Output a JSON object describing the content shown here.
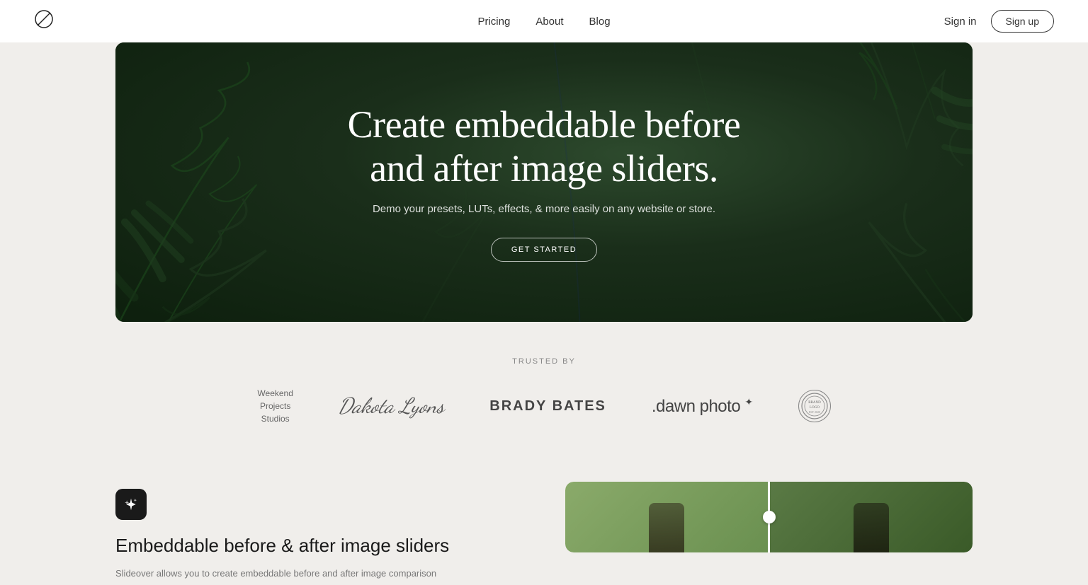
{
  "nav": {
    "logo_symbol": "∅",
    "links": [
      {
        "label": "Pricing",
        "href": "#"
      },
      {
        "label": "About",
        "href": "#"
      },
      {
        "label": "Blog",
        "href": "#"
      }
    ],
    "sign_in_label": "Sign in",
    "sign_up_label": "Sign up"
  },
  "hero": {
    "title_line1": "Create embeddable before",
    "title_line2": "and after image sliders.",
    "subtitle": "Demo your presets, LUTs, effects, & more easily on any website or store.",
    "cta_label": "GET STARTED"
  },
  "trusted": {
    "label": "TRUSTED BY",
    "logos": [
      {
        "id": "weekend",
        "text": "Weekend\nProjects\nStudios"
      },
      {
        "id": "dakota",
        "text": "Dakota Lyons"
      },
      {
        "id": "brady",
        "text": "BRADY BATES"
      },
      {
        "id": "dawn",
        "text": "dawn photo"
      },
      {
        "id": "circle",
        "text": ""
      }
    ]
  },
  "feature": {
    "icon": "✦",
    "title": "Embeddable before & after image sliders",
    "description": "Slideover allows you to create embeddable before and after image comparison"
  }
}
